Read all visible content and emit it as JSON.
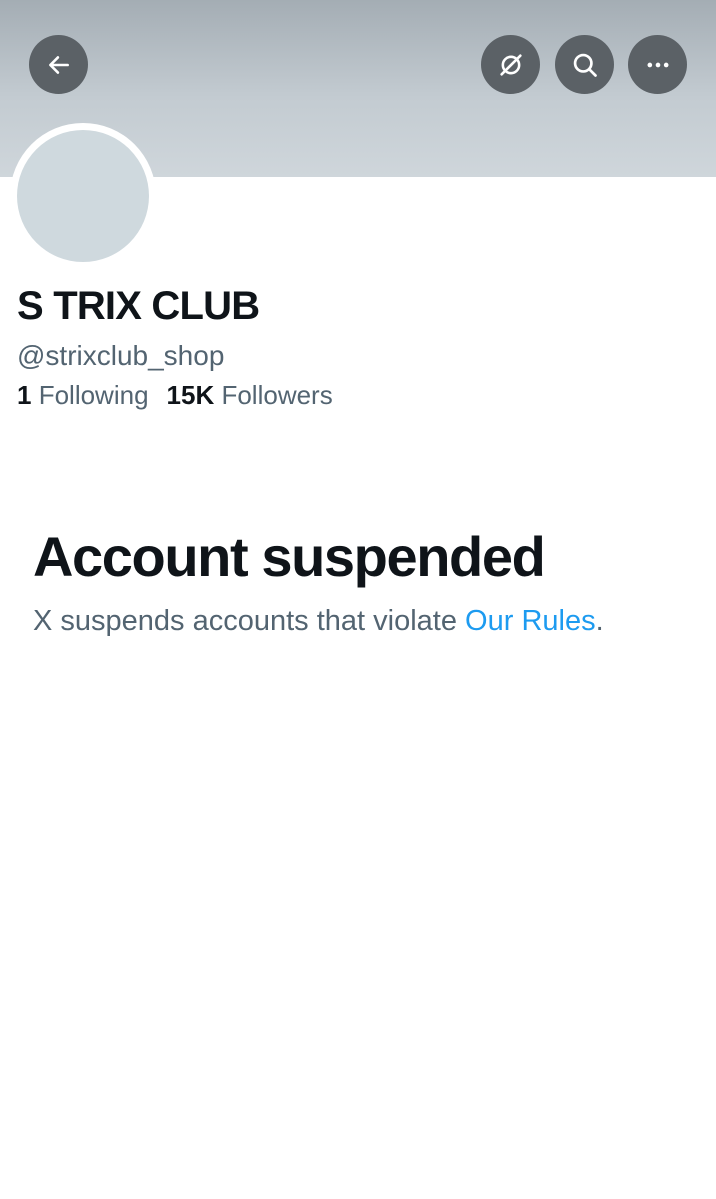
{
  "header": {
    "icons": {
      "back": "arrow-left-icon",
      "grok": "grok-icon",
      "search": "search-icon",
      "more": "more-horizontal-icon"
    }
  },
  "profile": {
    "display_name": "S TRIX CLUB",
    "handle": "@strixclub_shop",
    "following_count": "1",
    "following_label": "Following",
    "followers_count": "15K",
    "followers_label": "Followers"
  },
  "notice": {
    "title": "Account suspended",
    "text_before": "X suspends accounts that violate ",
    "link_text": "Our Rules",
    "text_after": "."
  },
  "colors": {
    "text_primary": "#0f1419",
    "text_secondary": "#536471",
    "link": "#1d9bf0",
    "avatar_placeholder": "#cfd9de",
    "header_button": "#5b6166"
  }
}
